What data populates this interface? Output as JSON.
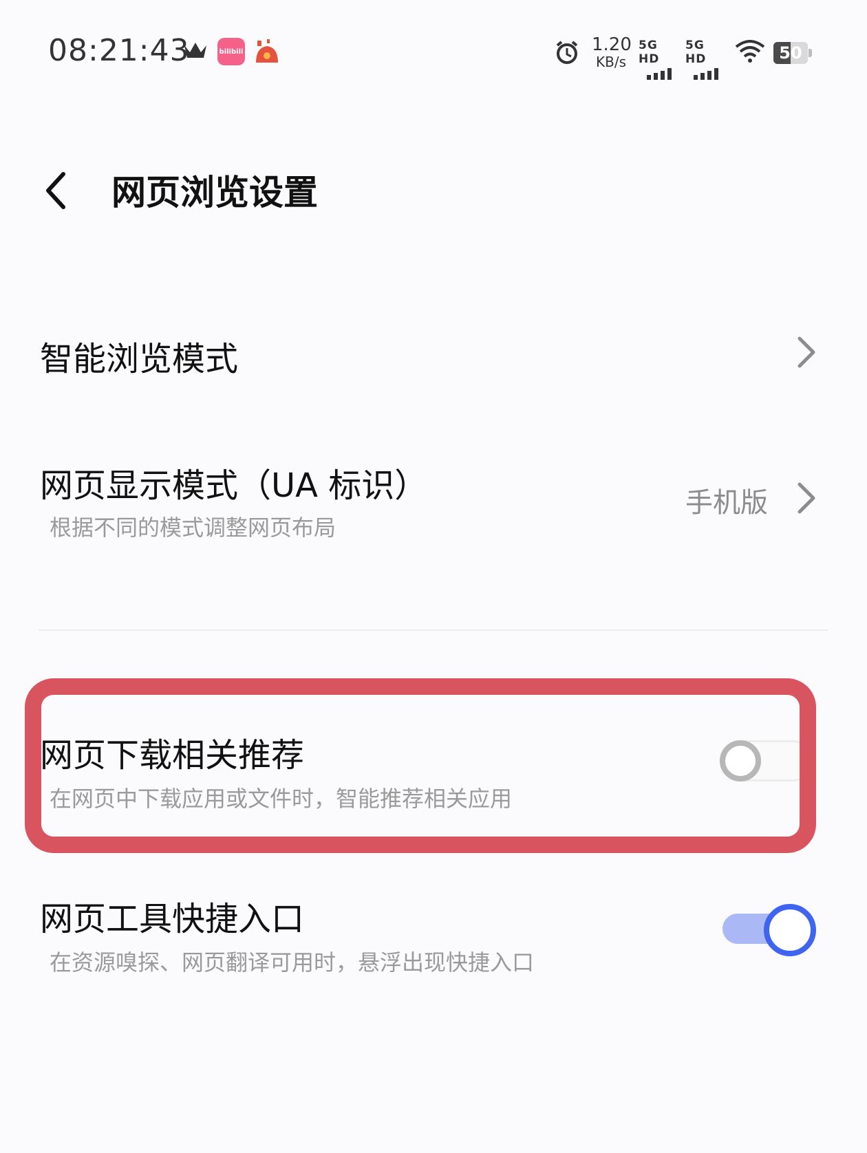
{
  "status_bar": {
    "time": "08:21:43",
    "bili_label": "bilibili",
    "net_speed_value": "1.20",
    "net_speed_unit": "KB/s",
    "sim1_label": "5G HD",
    "sim2_label": "5G HD",
    "battery_percent": "50",
    "battery_level": 0.5
  },
  "header": {
    "title": "网页浏览设置"
  },
  "settings": {
    "smart_browse": {
      "title": "智能浏览模式"
    },
    "ua_mode": {
      "title": "网页显示模式（UA 标识）",
      "subtitle": "根据不同的模式调整网页布局",
      "value": "手机版"
    },
    "download_recommend": {
      "title": "网页下载相关推荐",
      "subtitle": "在网页中下载应用或文件时，智能推荐相关应用",
      "enabled": false
    },
    "tool_shortcut": {
      "title": "网页工具快捷入口",
      "subtitle": "在资源嗅探、网页翻译可用时，悬浮出现快捷入口",
      "enabled": true
    }
  },
  "colors": {
    "highlight": "#d8545f",
    "toggle_on": "#3f64f0",
    "toggle_on_track": "#aab9f5"
  }
}
